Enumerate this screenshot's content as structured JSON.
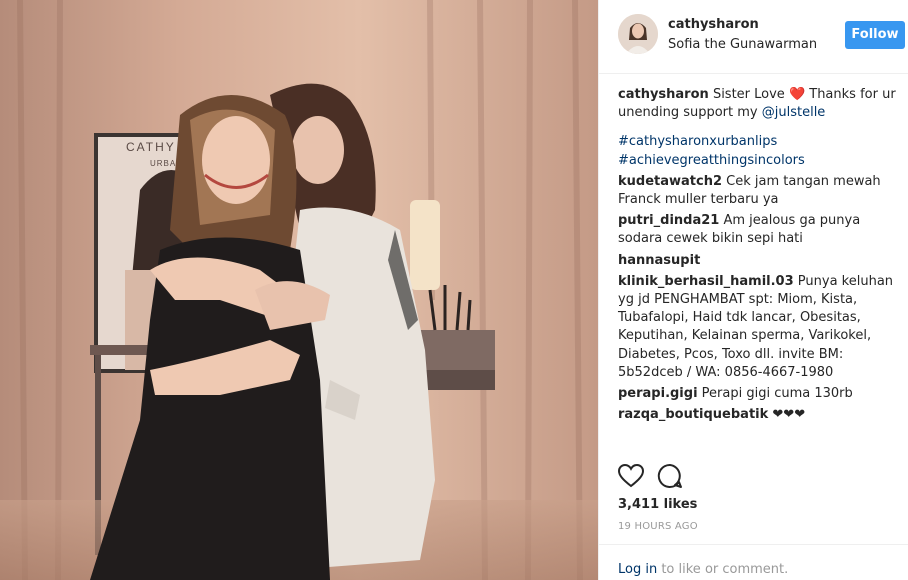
{
  "post": {
    "username": "cathysharon",
    "location": "Sofia the Gunawarman",
    "follow_label": "Follow",
    "caption_prefix": "Sister Love ❤️️ Thanks for ur unending support my ",
    "caption_mention": "@julstelle",
    "caption_suffix": " ",
    "hashtags": [
      "#cathysharonxurbanlips",
      "#achievegreatthingsincolors"
    ],
    "photo_text": {
      "brand": "CATHY SHA",
      "sub": "URBANLI"
    }
  },
  "comments": [
    {
      "user": "kudetawatch2",
      "text": "Cek jam tangan mewah Franck muller terbaru ya"
    },
    {
      "user": "putri_dinda21",
      "text": "Am jealous    ga punya sodara cewek bikin sepi hati   "
    },
    {
      "user": "hannasupit",
      "text": "   "
    },
    {
      "user": "klinik_berhasil_hamil.03",
      "text": "Punya keluhan yg jd PENGHAMBAT         spt: Miom, Kista, Tubafalopi, Haid tdk lancar, Obesitas, Keputihan, Kelainan sperma, Varikokel, Diabetes, Pcos, Toxo dll. invite BM: 5b52dceb / WA: 0856-4667-1980"
    },
    {
      "user": "perapi.gigi",
      "text": "Perapi gigi cuma 130rb "
    },
    {
      "user": "razqa_boutiquebatik",
      "text": "❤❤❤"
    }
  ],
  "stats": {
    "likes": "3,411 likes",
    "time": "19 HOURS AGO"
  },
  "footer": {
    "login_link": "Log in",
    "login_text": " to like or comment."
  },
  "icons": {
    "like": "heart-icon",
    "comment": "comment-icon"
  },
  "colors": {
    "accent": "#3897f0",
    "link": "#003569",
    "muted": "#999999"
  }
}
